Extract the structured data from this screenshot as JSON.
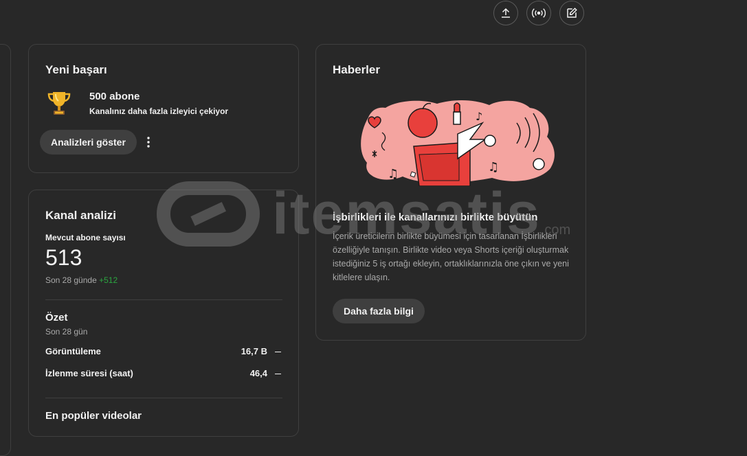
{
  "topbar": {
    "upload_icon": "upload-icon",
    "live_icon": "live-broadcast-icon",
    "create_post_icon": "edit-post-icon"
  },
  "achievement": {
    "title": "Yeni başarı",
    "milestone": "500 abone",
    "description": "Kanalınız daha fazla izleyici çekiyor",
    "button_label": "Analizleri göster",
    "more_icon": "more-vert-icon",
    "trophy_icon": "trophy-icon"
  },
  "analytics": {
    "title": "Kanal analizi",
    "subscriber_label": "Mevcut abone sayısı",
    "subscriber_count": "513",
    "period_text": "Son 28 günde",
    "delta": "+512",
    "summary_title": "Özet",
    "summary_period": "Son 28 gün",
    "rows": [
      {
        "label": "Görüntüleme",
        "value": "16,7 B"
      },
      {
        "label": "İzlenme süresi (saat)",
        "value": "46,4"
      }
    ],
    "popular_title": "En popüler videolar"
  },
  "news": {
    "title": "Haberler",
    "headline": "İşbirlikleri ile kanallarınızı birlikte büyütün",
    "body": "İçerik üreticilerin birlikte büyümesi için tasarlanan İşbirlikleri özelliğiyle tanışın. Birlikte video veya Shorts içeriği oluşturmak istediğiniz 5 iş ortağı ekleyin, ortaklıklarınızla öne çıkın ve yeni kitlelere ulaşın.",
    "button_label": "Daha fazla bilgi"
  },
  "watermark": {
    "text": "itemsatis",
    "suffix": ".com"
  },
  "colors": {
    "background": "#282828",
    "card_border": "#3f3f3f",
    "positive": "#2ba640",
    "illustration_pink": "#f4a4a0",
    "illustration_red": "#e8403c"
  }
}
